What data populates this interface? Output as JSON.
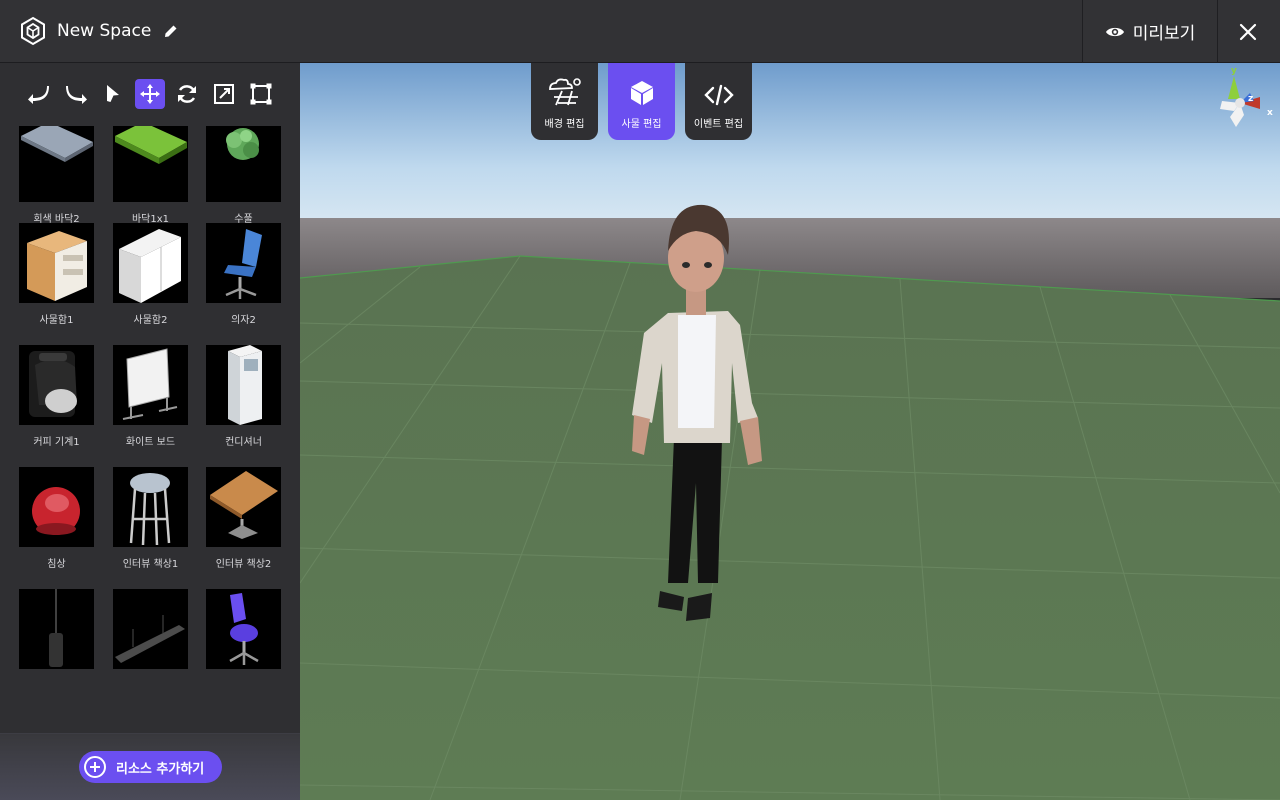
{
  "header": {
    "title": "New Space",
    "preview_label": "미리보기"
  },
  "toolbar": {
    "tools": [
      "undo",
      "redo",
      "select",
      "move",
      "rotate",
      "scale",
      "rect"
    ],
    "active": "move"
  },
  "assets": [
    {
      "label": "회색 바닥2"
    },
    {
      "label": "바닥1x1"
    },
    {
      "label": "수풀"
    },
    {
      "label": "사물함1"
    },
    {
      "label": "사물함2"
    },
    {
      "label": "의자2"
    },
    {
      "label": "커피 기계1"
    },
    {
      "label": "화이트 보드"
    },
    {
      "label": "컨디셔너"
    },
    {
      "label": "침상"
    },
    {
      "label": "인터뷰 책상1"
    },
    {
      "label": "인터뷰 책상2"
    },
    {
      "label": ""
    },
    {
      "label": ""
    },
    {
      "label": ""
    }
  ],
  "sidebar": {
    "add_resource_label": "리소스 추가하기"
  },
  "modes": [
    {
      "label": "배경 편집",
      "icon": "background-edit-icon"
    },
    {
      "label": "사물 편집",
      "icon": "object-edit-icon"
    },
    {
      "label": "이벤트 편집",
      "icon": "code-icon"
    }
  ],
  "gizmo": {
    "axes": [
      "y",
      "z",
      "x"
    ]
  },
  "colors": {
    "accent": "#6b4ff0",
    "panel": "#2f2f32",
    "ground": "#5c7752"
  }
}
